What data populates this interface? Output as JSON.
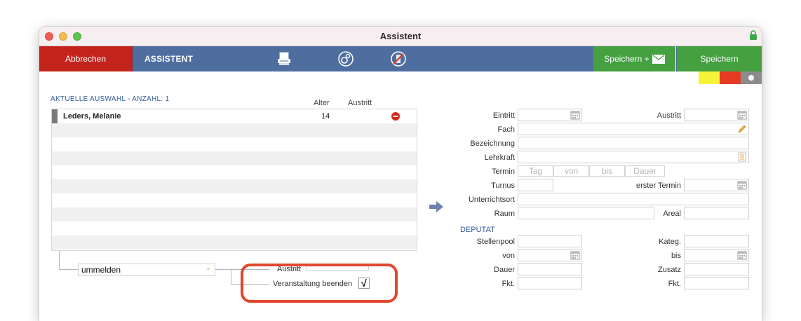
{
  "window": {
    "title": "Assistent"
  },
  "toolbar": {
    "cancel_label": "Abbrechen",
    "section_label": "ASSISTENT",
    "icons": [
      "printer-icon",
      "settings-icon",
      "no-entry-icon"
    ],
    "save_mail_label": "Speichern +",
    "save_label": "Speichern"
  },
  "colors": {
    "toolbar": "#4f6ea0",
    "cancel": "#c4231b",
    "save": "#45a040",
    "strip": [
      "#f6f43a",
      "#e53a23",
      "#8c8c8c"
    ]
  },
  "selection": {
    "title": "AKTUELLE AUSWAHL - ANZAHL: 1",
    "columns": {
      "age": "Alter",
      "exit": "Austritt"
    },
    "rows": [
      {
        "name": "Leders, Melanie",
        "age": "14",
        "exit": ""
      }
    ]
  },
  "action": {
    "select_value": "ummelden",
    "austritt_label": "Austritt",
    "end_event_label": "Veranstaltung beenden",
    "end_event_checked": "√"
  },
  "form": {
    "eintritt": "Eintritt",
    "austritt": "Austritt",
    "fach": "Fach",
    "bezeichnung": "Bezeichnung",
    "lehrkraft": "Lehrkraft",
    "termin": "Termin",
    "termin_placeholders": {
      "tag": "Tag",
      "von": "von",
      "bis": "bis",
      "dauer": "Dauer"
    },
    "turnus": "Turnus",
    "erster_termin": "erster Termin",
    "unterrichtsort": "Unterrichtsort",
    "raum": "Raum",
    "areal": "Areal"
  },
  "deputat": {
    "title": "DEPUTAT",
    "stellenpool": "Stellenpool",
    "kateg": "Kateg.",
    "von": "von",
    "bis": "bis",
    "dauer": "Dauer",
    "zusatz": "Zusatz",
    "fkt_left": "Fkt.",
    "fkt_right": "Fkt."
  }
}
